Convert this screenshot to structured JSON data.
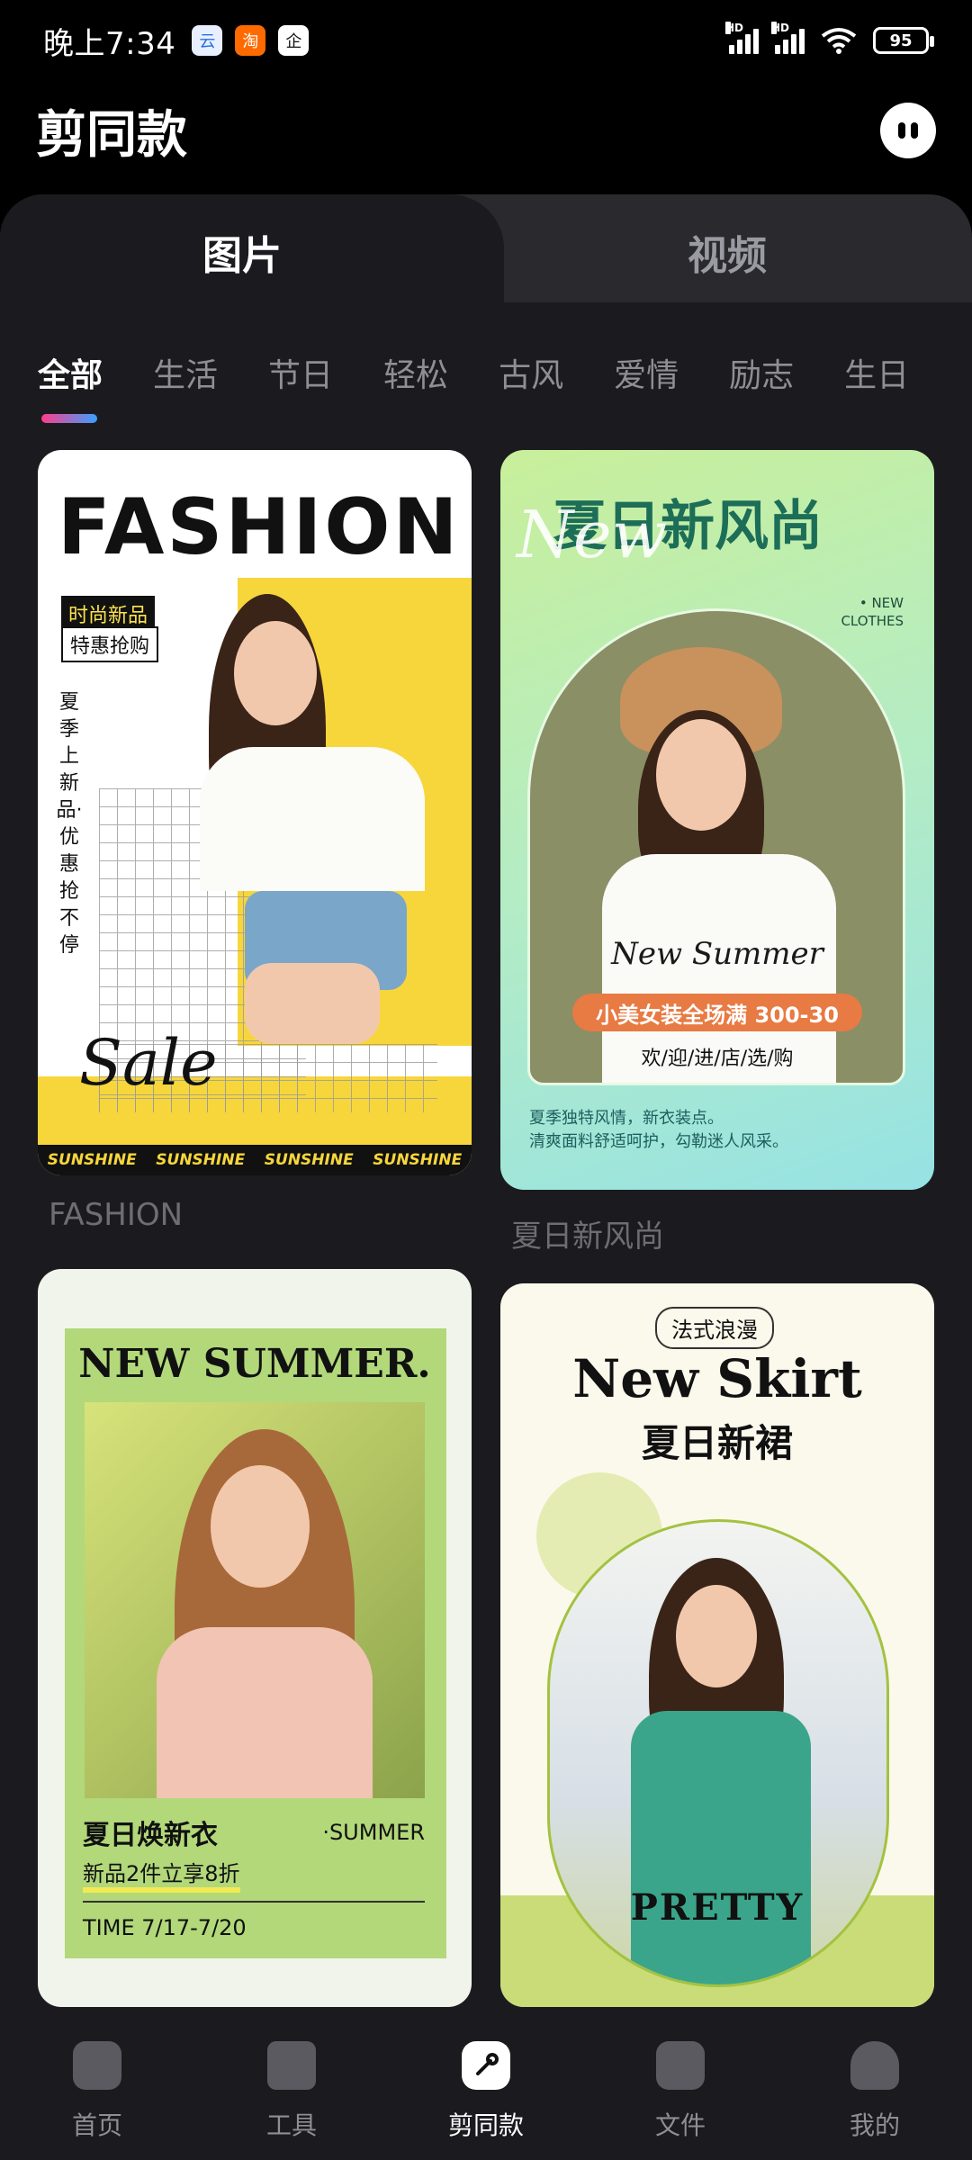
{
  "status": {
    "time": "晚上7:34",
    "apps": [
      "云",
      "淘",
      "企"
    ],
    "network": [
      "HD",
      "HD"
    ],
    "battery": "95"
  },
  "header": {
    "title": "剪同款"
  },
  "segment": {
    "tabs": [
      "图片",
      "视频"
    ],
    "active": 0
  },
  "categories": [
    "全部",
    "生活",
    "节日",
    "轻松",
    "古风",
    "爱情",
    "励志",
    "生日"
  ],
  "cards": [
    {
      "caption": "FASHION",
      "poster_title": "FASHION",
      "tag1": "时尚新品",
      "tag2": "特惠抢购",
      "vertical_text": "夏季上新品·优惠抢不停",
      "script_word": "Sale",
      "footer": [
        "SUNSHINE",
        "SUNSHINE",
        "SUNSHINE",
        "SUNSHINE"
      ]
    },
    {
      "caption": "夏日新风尚",
      "poster_title": "夏日新风尚",
      "overlay": "New",
      "corner_text_1": "• NEW",
      "corner_text_2": "CLOTHES",
      "subtitle": "New Summer",
      "promo": "小美女装全场满 300-30",
      "welcome": "欢/迎/进/店/选/购",
      "desc_1": "夏季独特风情，新衣装点。",
      "desc_2": "清爽面料舒适呵护，勾勒迷人风采。"
    },
    {
      "poster_title": "NEW SUMMER.",
      "line1": "夏日焕新衣",
      "line1_right": "·SUMMER",
      "line2": "新品2件立享8折",
      "line3": "TIME 7/17-7/20"
    },
    {
      "badge": "法式浪漫",
      "title_en": "New Skirt",
      "title_cn": "夏日新裙",
      "bottom": "PRETTY"
    }
  ],
  "nav": [
    {
      "label": "首页",
      "icon": "home-icon"
    },
    {
      "label": "工具",
      "icon": "tools-icon"
    },
    {
      "label": "剪同款",
      "icon": "template-icon"
    },
    {
      "label": "文件",
      "icon": "folder-icon"
    },
    {
      "label": "我的",
      "icon": "profile-icon"
    }
  ],
  "colors": {
    "background": "#000000",
    "panel": "#1b1b1f",
    "inactive_text": "#8e8e94",
    "indicator_start": "#ff3d8b",
    "indicator_end": "#3aa0ff"
  }
}
